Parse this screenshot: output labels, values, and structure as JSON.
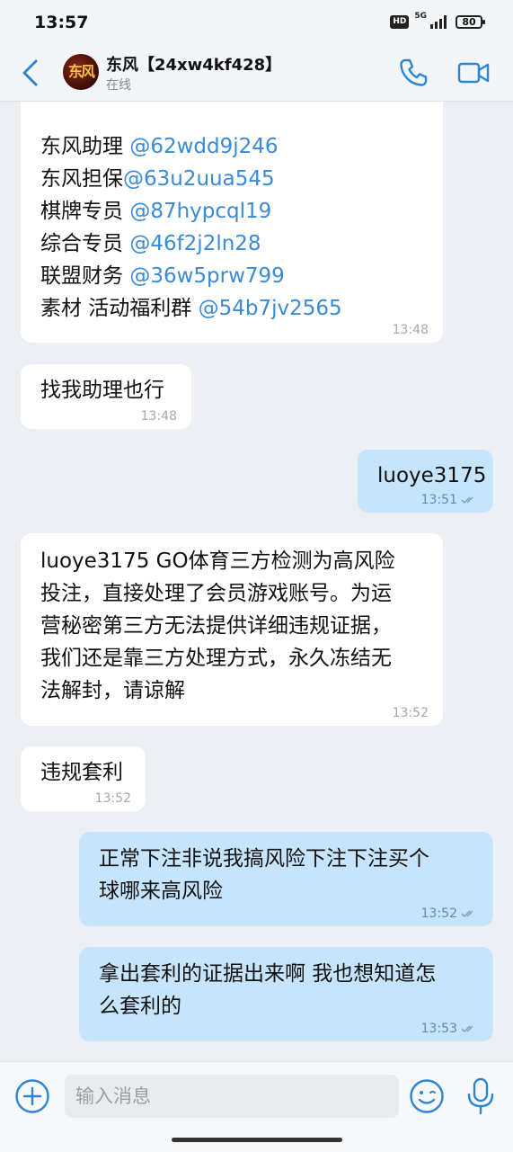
{
  "status_bar": {
    "time": "13:57",
    "hd": "HD",
    "network": "5G",
    "battery": "80"
  },
  "header": {
    "avatar_text": "东风",
    "title": "东风【24xw4kf428】",
    "status": "在线"
  },
  "messages": [
    {
      "side": "in",
      "lines": [
        {
          "label": "东风助理 ",
          "handle": "@62wdd9j246"
        },
        {
          "label": "东风担保",
          "handle": "@63u2uua545"
        },
        {
          "label": "棋牌专员 ",
          "handle": "@87hypcql19"
        },
        {
          "label": "综合专员 ",
          "handle": "@46f2j2ln28"
        },
        {
          "label": "联盟财务 ",
          "handle": "@36w5prw799"
        },
        {
          "label": "素材 活动福利群 ",
          "handle": "@54b7jv2565"
        }
      ],
      "time": "13:48"
    },
    {
      "side": "in",
      "text": "找我助理也行",
      "time": "13:48"
    },
    {
      "side": "out",
      "text": "luoye3175",
      "time": "13:51"
    },
    {
      "side": "in",
      "text": "luoye3175 GO体育三方检测为高风险\n投注，直接处理了会员游戏账号。为运\n营秘密第三方无法提供详细违规证据，\n我们还是靠三方处理方式，永久冻结无\n法解封，请谅解",
      "time": "13:52"
    },
    {
      "side": "in",
      "text": "违规套利",
      "time": "13:52"
    },
    {
      "side": "out",
      "text": "正常下注非说我搞风险下注下注买个\n球哪来高风险",
      "time": "13:52"
    },
    {
      "side": "out",
      "text": "拿出套利的证据出来啊 我也想知道怎\n么套利的",
      "time": "13:53"
    }
  ],
  "input": {
    "placeholder": "输入消息"
  },
  "colors": {
    "accent": "#2c86d4",
    "link": "#3a8ad6",
    "outgoing_bubble": "#c6e4fc",
    "incoming_bubble": "#ffffff",
    "background": "#ecf0f4"
  }
}
